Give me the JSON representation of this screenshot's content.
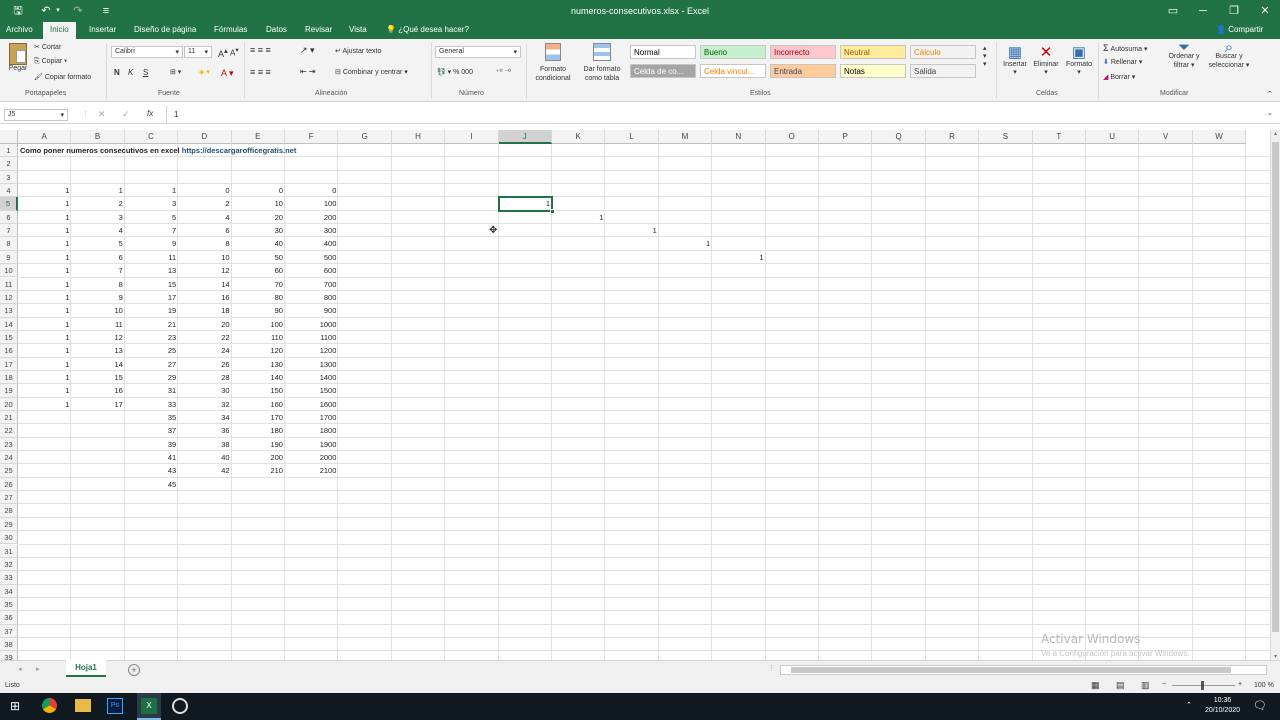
{
  "titlebar": {
    "filename": "numeros-consecutivos.xlsx - Excel",
    "save_icon": "save-icon",
    "undo_icon": "undo-icon",
    "redo_icon": "redo-icon",
    "minimize": "─",
    "restore": "❐",
    "close": "✕",
    "ribbon_display": "▭"
  },
  "tabs": [
    "Archivo",
    "Inicio",
    "Insertar",
    "Diseño de página",
    "Fórmulas",
    "Datos",
    "Revisar",
    "Vista",
    "¿Qué desea hacer?"
  ],
  "share": "Compartir",
  "ribbon": {
    "clipboard": {
      "paste": "Pegar",
      "cut": "Cortar",
      "copy": "Copiar",
      "format_painter": "Copiar formato",
      "label": "Portapapeles"
    },
    "font": {
      "name": "Calibri",
      "size": "11",
      "bold": "N",
      "italic": "K",
      "underline": "S",
      "label": "Fuente"
    },
    "alignment": {
      "wrap": "Ajustar texto",
      "merge": "Combinar y centrar",
      "label": "Alineación"
    },
    "number": {
      "format": "General",
      "label": "Número"
    },
    "styles": {
      "conditional": "Formato condicional",
      "as_table": "Dar formato como tabla",
      "cells": [
        {
          "text": "Normal",
          "bg": "#ffffff",
          "fg": "#000000"
        },
        {
          "text": "Bueno",
          "bg": "#c6efce",
          "fg": "#006100"
        },
        {
          "text": "Incorrecto",
          "bg": "#ffc7ce",
          "fg": "#9c0006"
        },
        {
          "text": "Neutral",
          "bg": "#ffeb9c",
          "fg": "#9c5700"
        },
        {
          "text": "Cálculo",
          "bg": "#f2f2f2",
          "fg": "#fa7d00"
        },
        {
          "text": "Celda de co...",
          "bg": "#a5a5a5",
          "fg": "#ffffff"
        },
        {
          "text": "Celda vincul...",
          "bg": "#ffffff",
          "fg": "#fa7d00"
        },
        {
          "text": "Entrada",
          "bg": "#ffcc99",
          "fg": "#3f3f76"
        },
        {
          "text": "Notas",
          "bg": "#ffffcc",
          "fg": "#000000"
        },
        {
          "text": "Salida",
          "bg": "#f2f2f2",
          "fg": "#3f3f3f"
        }
      ],
      "label": "Estilos"
    },
    "cells": {
      "insert": "Insertar",
      "delete": "Eliminar",
      "format": "Formato",
      "label": "Celdas"
    },
    "editing": {
      "autosum": "Autosuma",
      "fill": "Rellenar",
      "clear": "Borrar",
      "sort": "Ordenar y filtrar",
      "find": "Buscar y seleccionar",
      "label": "Modificar"
    }
  },
  "formula_bar": {
    "name_box": "J5",
    "fx": "fx",
    "value": "1"
  },
  "columns": [
    "A",
    "B",
    "C",
    "D",
    "E",
    "F",
    "G",
    "H",
    "I",
    "J",
    "K",
    "L",
    "M",
    "N",
    "O",
    "P",
    "Q",
    "R",
    "S",
    "T",
    "U",
    "V",
    "W"
  ],
  "rows": [
    "1",
    "2",
    "3",
    "4",
    "5",
    "6",
    "7",
    "8",
    "9",
    "10",
    "11",
    "12",
    "13",
    "14",
    "15",
    "16",
    "17",
    "18",
    "19",
    "20",
    "21",
    "22",
    "23",
    "24",
    "25",
    "26",
    "27",
    "28",
    "29",
    "30",
    "31",
    "32",
    "33",
    "34",
    "35",
    "36",
    "37",
    "38",
    "39"
  ],
  "selected": {
    "column": "J",
    "row": "5"
  },
  "title_cell": {
    "text": "Como poner numeros consecutivos en excel",
    "link": "https://descargarofficegratis.net"
  },
  "data": {
    "A": [
      "1",
      "1",
      "1",
      "1",
      "1",
      "1",
      "1",
      "1",
      "1",
      "1",
      "1",
      "1",
      "1",
      "1",
      "1",
      "1",
      "1"
    ],
    "B": [
      "1",
      "2",
      "3",
      "4",
      "5",
      "6",
      "7",
      "8",
      "9",
      "10",
      "11",
      "12",
      "13",
      "14",
      "15",
      "16",
      "17"
    ],
    "C": [
      "1",
      "3",
      "5",
      "7",
      "9",
      "11",
      "13",
      "15",
      "17",
      "19",
      "21",
      "23",
      "25",
      "27",
      "29",
      "31",
      "33",
      "35",
      "37",
      "39",
      "41",
      "43",
      "45"
    ],
    "D": [
      "0",
      "2",
      "4",
      "6",
      "8",
      "10",
      "12",
      "14",
      "16",
      "18",
      "20",
      "22",
      "24",
      "26",
      "28",
      "30",
      "32",
      "34",
      "36",
      "38",
      "40",
      "42"
    ],
    "E": [
      "0",
      "10",
      "20",
      "30",
      "40",
      "50",
      "60",
      "70",
      "80",
      "90",
      "100",
      "110",
      "120",
      "130",
      "140",
      "150",
      "160",
      "170",
      "180",
      "190",
      "200",
      "210"
    ],
    "F": [
      "0",
      "100",
      "200",
      "300",
      "400",
      "500",
      "600",
      "700",
      "800",
      "900",
      "1000",
      "1100",
      "1200",
      "1300",
      "1400",
      "1500",
      "1600",
      "1700",
      "1800",
      "1900",
      "2000",
      "2100"
    ]
  },
  "diagonal": [
    "1",
    "1",
    "1",
    "1",
    "1"
  ],
  "sheet_tab": "Hoja1",
  "status": {
    "text": "Listo",
    "zoom": "100 %"
  },
  "watermark": {
    "line1": "Activar Windows",
    "line2": "Ve a Configuración para activar Windows."
  },
  "clock": {
    "time": "10:36",
    "date": "20/10/2020"
  }
}
